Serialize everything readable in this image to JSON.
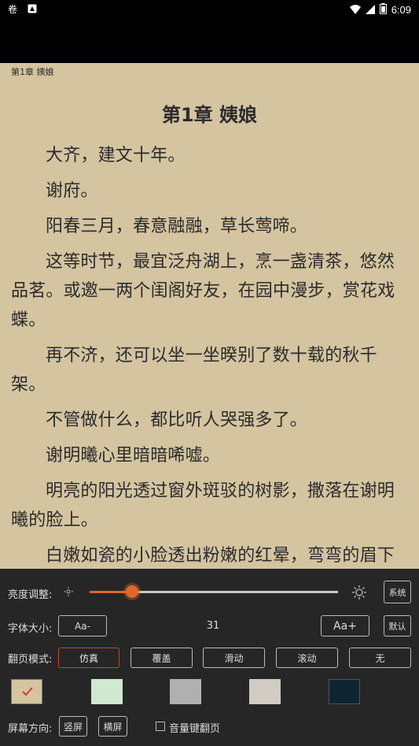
{
  "status": {
    "time": "6:09"
  },
  "reader": {
    "header": "第1章 姨娘",
    "title": "第1章 姨娘",
    "paragraphs": [
      "大齐，建文十年。",
      "谢府。",
      "阳春三月，春意融融，草长莺啼。",
      "这等时节，最宜泛舟湖上，烹一盏清茶，悠然品茗。或邀一两个闺阁好友，在园中漫步，赏花戏蝶。",
      "再不济，还可以坐一坐暌别了数十载的秋千架。",
      "不管做什么，都比听人哭强多了。",
      "谢明曦心里暗暗唏嘘。",
      "明亮的阳光透过窗外斑驳的树影，撒落在谢明曦的脸上。",
      "白嫩如瓷的小脸透出粉嫩的红晕，弯弯的眉下"
    ]
  },
  "settings": {
    "brightness_label": "亮度调整:",
    "brightness_level": 0.17,
    "system_label": "系统",
    "font_label": "字体大小:",
    "font_decrease": "Aa-",
    "font_size_value": "31",
    "font_increase": "Aa+",
    "default_label": "默认",
    "page_mode_label": "翻页模式:",
    "page_modes": [
      "仿真",
      "覆盖",
      "滑动",
      "滚动",
      "无"
    ],
    "active_page_mode": "仿真",
    "themes": [
      "#d4c4a0",
      "#cfe8cf",
      "#b0b0b0",
      "#d0ccc4",
      "#0d2530"
    ],
    "selected_theme": 0,
    "accent_color": "#e0662c",
    "orientation_label": "屏幕方向:",
    "portrait_label": "竖屏",
    "landscape_label": "横屏",
    "volume_key_label": "音量键翻页"
  }
}
